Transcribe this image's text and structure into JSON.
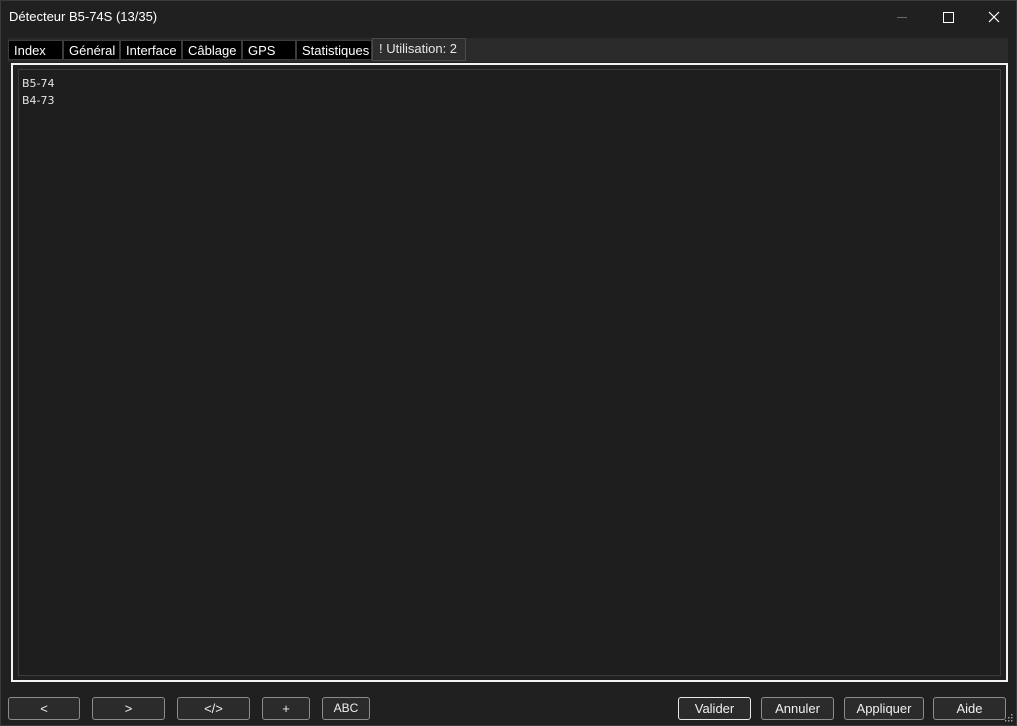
{
  "window": {
    "title": "Détecteur B5-74S (13/35)",
    "close_glyph": "✕"
  },
  "tabs": [
    {
      "label": "Index"
    },
    {
      "label": "Général"
    },
    {
      "label": "Interface"
    },
    {
      "label": "Câblage"
    },
    {
      "label": "GPS"
    },
    {
      "label": "Statistiques"
    },
    {
      "label": "! Utilisation: 2",
      "active": true
    }
  ],
  "usage_list": {
    "items": [
      "B5-74",
      "B4-73"
    ]
  },
  "nav_buttons": {
    "previous": "<",
    "next": ">",
    "code": "</>",
    "add": "+",
    "abc": "ABC"
  },
  "dialog_buttons": {
    "validate": "Valider",
    "cancel": "Annuler",
    "apply": "Appliquer",
    "help": "Aide"
  },
  "colors": {
    "background": "#202020",
    "panel_border": "#f2f2f2",
    "text": "#e8e8e8",
    "inactive_tab": "#000000",
    "active_tab": "#2e2e2e"
  },
  "icons": [
    "minimize-icon",
    "maximize-icon",
    "close-icon",
    "resize-grip-icon"
  ]
}
